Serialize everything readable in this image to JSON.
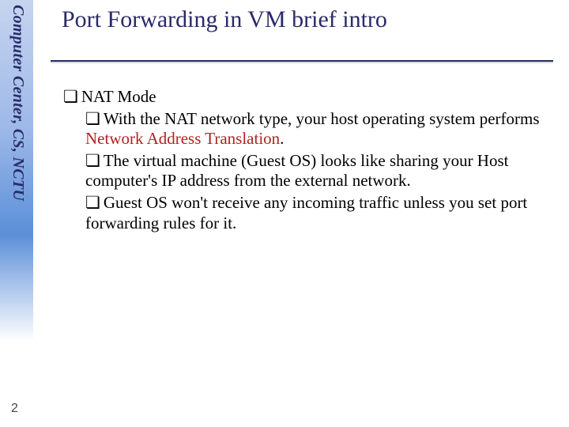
{
  "sidebar": {
    "org_text": "Computer Center, CS, NCTU"
  },
  "slide": {
    "title": "Port Forwarding in VM brief intro",
    "page_number": "2"
  },
  "glyphs": {
    "bullet": "❏"
  },
  "content": {
    "l1": "NAT Mode",
    "l2a": "With the NAT network type, your host operating system performs ",
    "l2b_hl": "Network Address Translation",
    "l2c": ".",
    "l3": "The virtual machine (Guest OS) looks like sharing your Host computer's IP address from the external network.",
    "l4": "Guest OS won't receive any incoming traffic unless you set port forwarding rules for it."
  }
}
